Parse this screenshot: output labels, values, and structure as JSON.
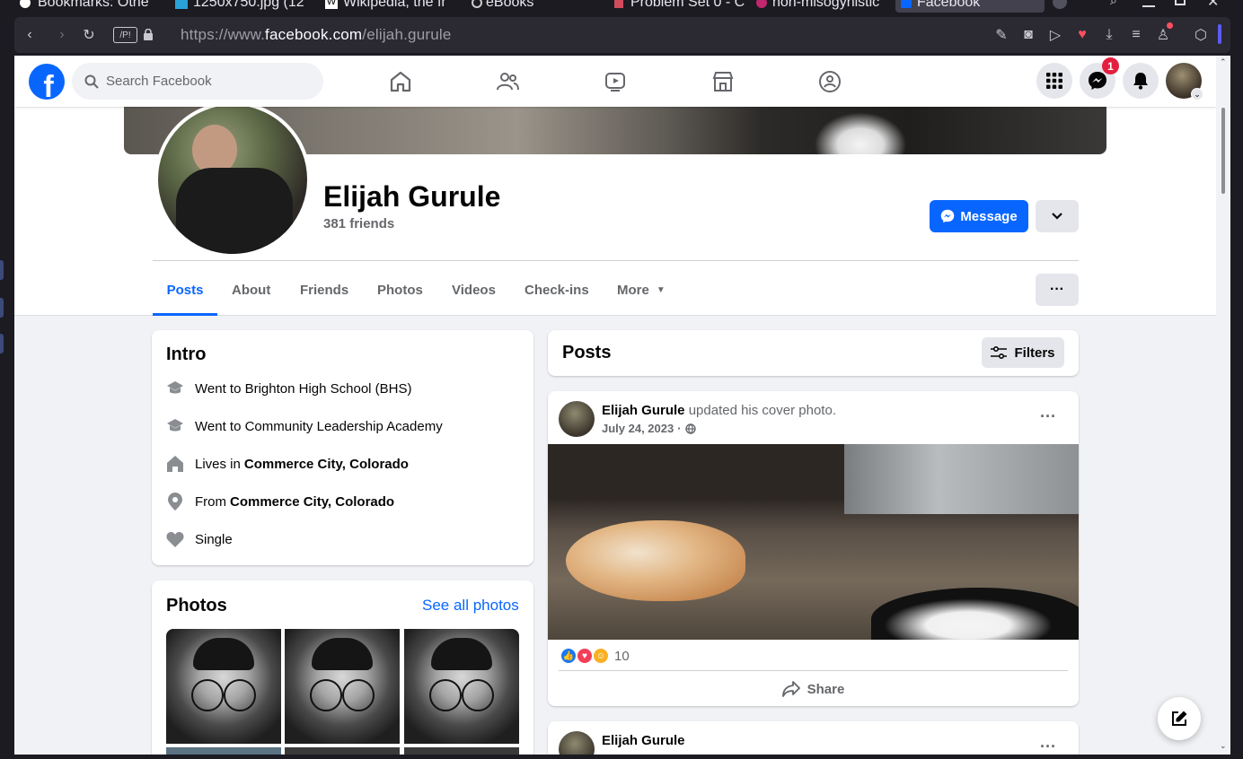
{
  "browser": {
    "tabs": [
      {
        "title": "Bookmarks: Othe"
      },
      {
        "title": "1250x750.jpg (12"
      },
      {
        "title": "Wikipedia, the fr"
      },
      {
        "title": "eBooks"
      },
      {
        "title": "Problem Set 0 - C"
      },
      {
        "title": "non-misogynistic"
      },
      {
        "title": "Facebook"
      }
    ],
    "url_prefix": "https://www.",
    "url_host": "facebook.com",
    "url_path": "/elijah.gurule",
    "reader_label": "/P!"
  },
  "header": {
    "search_placeholder": "Search Facebook",
    "messenger_badge": "1",
    "accent": "#0866ff"
  },
  "profile": {
    "name": "Elijah Gurule",
    "friends": "381 friends",
    "message_label": "Message",
    "tabs": [
      "Posts",
      "About",
      "Friends",
      "Photos",
      "Videos",
      "Check-ins",
      "More"
    ],
    "more_button": "···"
  },
  "intro": {
    "title": "Intro",
    "items": [
      {
        "icon": "graduation-cap-icon",
        "text": "Went to Brighton High School (BHS)",
        "bold": ""
      },
      {
        "icon": "graduation-cap-icon",
        "text": "Went to Community Leadership Academy",
        "bold": ""
      },
      {
        "icon": "house-icon",
        "text": "Lives in",
        "bold": "Commerce City, Colorado"
      },
      {
        "icon": "location-pin-icon",
        "text": "From",
        "bold": "Commerce City, Colorado"
      },
      {
        "icon": "heart-icon",
        "text": "Single",
        "bold": ""
      }
    ]
  },
  "photos": {
    "title": "Photos",
    "see_all": "See all photos"
  },
  "posts": {
    "title": "Posts",
    "filters_label": "Filters",
    "items": [
      {
        "author": "Elijah Gurule",
        "action": "updated his cover photo.",
        "date": "July 24, 2023",
        "dot": "·",
        "reaction_count": "10",
        "share_label": "Share",
        "more": "···"
      },
      {
        "author": "Elijah Gurule",
        "more": "···"
      }
    ]
  }
}
